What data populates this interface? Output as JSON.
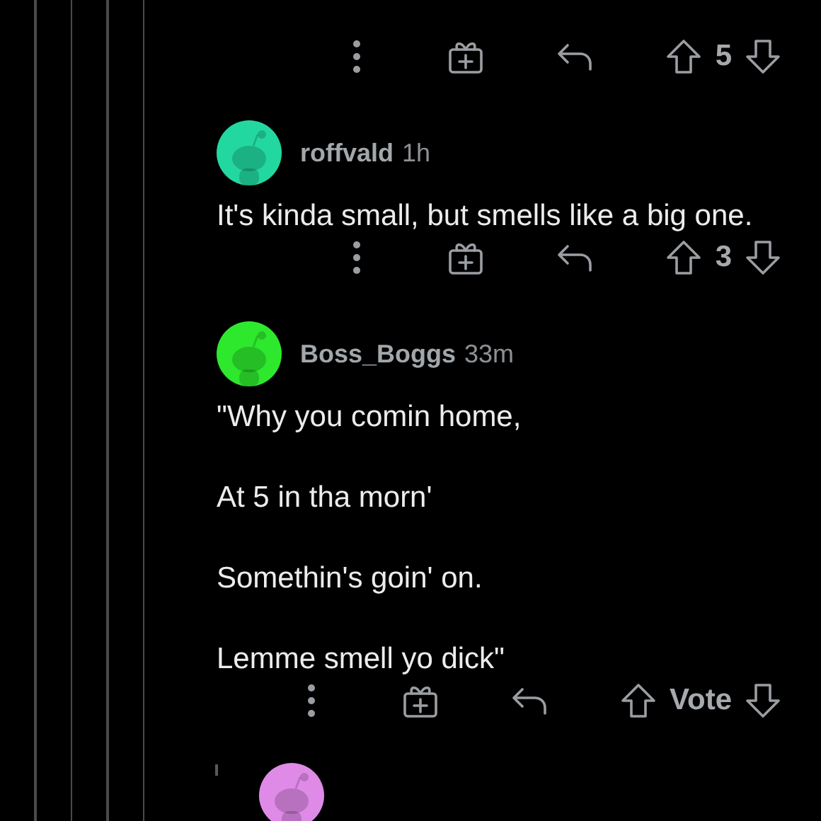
{
  "thread": [
    {
      "kind": "actions",
      "score": "5"
    },
    {
      "kind": "comment",
      "author": "roffvald",
      "time": "1h",
      "color": "#22d8a0",
      "paragraphs": [
        "It's kinda small, but smells like a big one."
      ],
      "score": "3"
    },
    {
      "kind": "comment",
      "author": "Boss_Boggs",
      "time": "33m",
      "color": "#2ee82e",
      "paragraphs": [
        "\"Why you comin home,",
        "At 5 in tha morn'",
        "Somethin's goin' on.",
        "Lemme smell yo dick\""
      ],
      "score": "Vote"
    },
    {
      "kind": "partial",
      "color": "#e08ae8"
    }
  ]
}
